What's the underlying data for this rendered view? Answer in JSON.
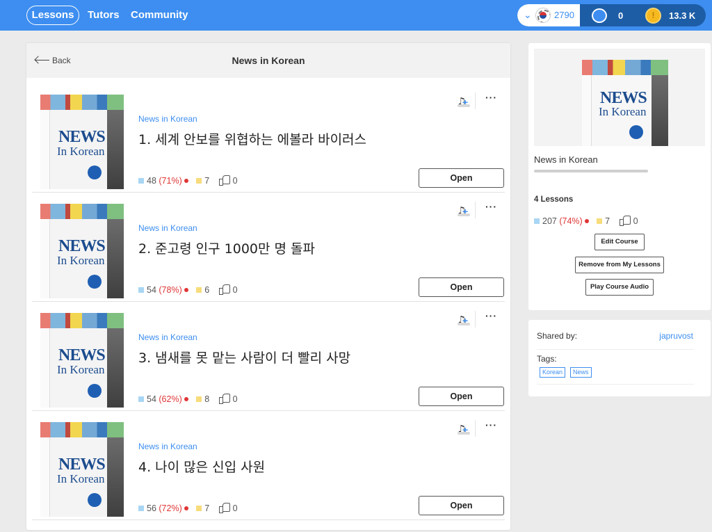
{
  "nav": {
    "lessons": "Lessons",
    "tutors": "Tutors",
    "community": "Community"
  },
  "stats": {
    "language_icon": "south-korea-flag",
    "known_words": "2790",
    "apples": "0",
    "coins": "13.3 K"
  },
  "main": {
    "back_label": "Back",
    "title": "News in Korean",
    "lessons": [
      {
        "category": "News in Korean",
        "title": "1. 세계 안보를 위협하는 에볼라 바이러스",
        "new_words": "48",
        "new_pct": "(71%)",
        "lingqs": "7",
        "likes": "0",
        "open_label": "Open"
      },
      {
        "category": "News in Korean",
        "title": "2. 준고령 인구 1000만 명 돌파",
        "new_words": "54",
        "new_pct": "(78%)",
        "lingqs": "6",
        "likes": "0",
        "open_label": "Open"
      },
      {
        "category": "News in Korean",
        "title": "3. 냄새를 못 맡는 사람이 더 빨리 사망",
        "new_words": "54",
        "new_pct": "(62%)",
        "lingqs": "8",
        "likes": "0",
        "open_label": "Open"
      },
      {
        "category": "News in Korean",
        "title": "4. 나이 많은 신입 사원",
        "new_words": "56",
        "new_pct": "(72%)",
        "lingqs": "7",
        "likes": "0",
        "open_label": "Open"
      }
    ]
  },
  "cover": {
    "news": "NEWS",
    "in_korean": "In Korean"
  },
  "side": {
    "title": "News in Korean",
    "lesson_count": "4 Lessons",
    "new_words": "207",
    "new_pct": "(74%)",
    "lingqs": "7",
    "likes": "0",
    "edit_course": "Edit Course",
    "remove": "Remove from My Lessons",
    "play_audio": "Play Course Audio"
  },
  "shared": {
    "label": "Shared by:",
    "user": "japruvost",
    "tags_label": "Tags:",
    "tags": [
      "Korean",
      "News"
    ]
  },
  "colors": {
    "brand_blue": "#3d8ef0",
    "dark_blue": "#1d5da6",
    "warning_red": "#e03535"
  }
}
